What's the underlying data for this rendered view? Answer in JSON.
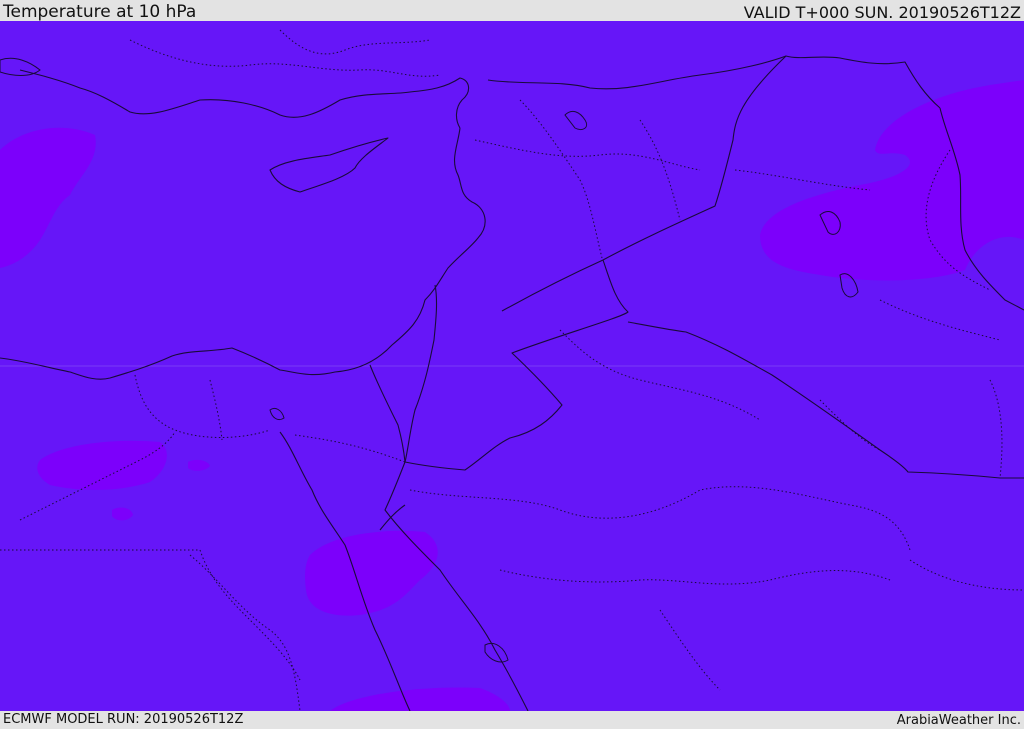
{
  "header": {
    "title": "Temperature at 10 hPa",
    "valid": "VALID T+000 SUN. 20190526T12Z"
  },
  "footer": {
    "model_run": "ECMWF MODEL RUN: 20190526T12Z",
    "credit": "ArabiaWeather Inc."
  },
  "map": {
    "field": "Temperature at 10 hPa",
    "colors": {
      "base_fill": "#6616f8",
      "warm_patch": "#7c00fb",
      "border_line": "#1a0a3a",
      "page_bg": "#e3e3e3"
    }
  }
}
